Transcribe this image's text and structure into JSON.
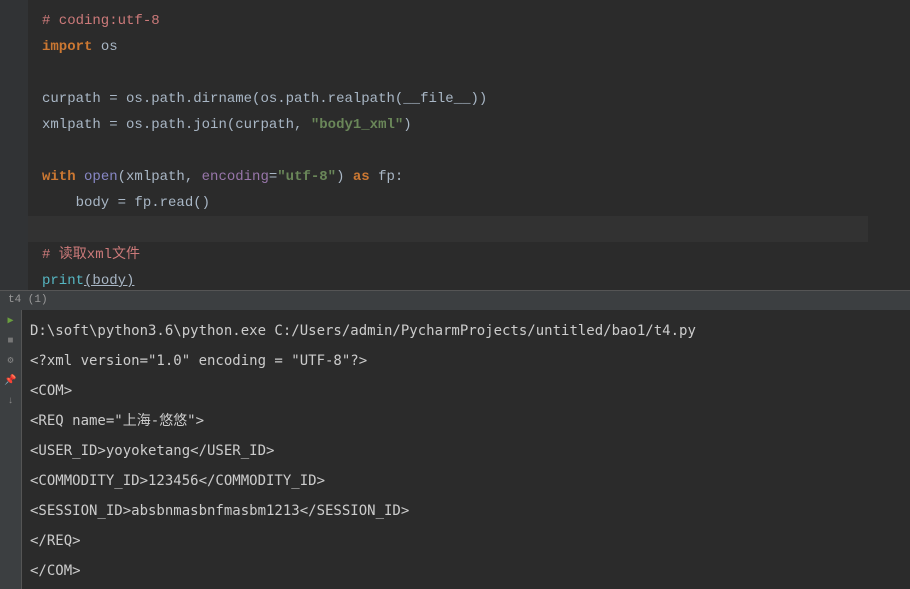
{
  "editor": {
    "lines": {
      "l1_comment": "# coding:utf-8",
      "l2_import": "import",
      "l2_os": " os",
      "l4_var1": "curpath ",
      "l4_eq": "= ",
      "l4_call": "os.path.dirname(os.path.realpath(",
      "l4_dunder": "__file__",
      "l4_close": "))",
      "l5_var1": "xmlpath ",
      "l5_eq": "= ",
      "l5_call": "os.path.join(curpath, ",
      "l5_str": "\"body1_xml\"",
      "l5_close": ")",
      "l7_with": "with",
      "l7_open": " open",
      "l7_p1": "(xmlpath, ",
      "l7_enc": "encoding",
      "l7_eq": "=",
      "l7_str": "\"utf-8\"",
      "l7_p2": ") ",
      "l7_as": "as",
      "l7_fp": " fp:",
      "l8_body": "    body = fp.read()",
      "l10_comment": "# 读取xml文件",
      "l11_print": "print",
      "l11_body": "(body)"
    }
  },
  "tabbar": {
    "tab1": "t4 (1)"
  },
  "console": {
    "l1": "D:\\soft\\python3.6\\python.exe C:/Users/admin/PycharmProjects/untitled/bao1/t4.py",
    "l2": "<?xml version=\"1.0\" encoding = \"UTF-8\"?>",
    "l3": "<COM>",
    "l4": "<REQ name=\"上海-悠悠\">",
    "l5": "<USER_ID>yoyoketang</USER_ID>",
    "l6": "<COMMODITY_ID>123456</COMMODITY_ID>",
    "l7": "<SESSION_ID>absbnmasbnfmasbm1213</SESSION_ID>",
    "l8": "</REQ>",
    "l9": "</COM>"
  }
}
